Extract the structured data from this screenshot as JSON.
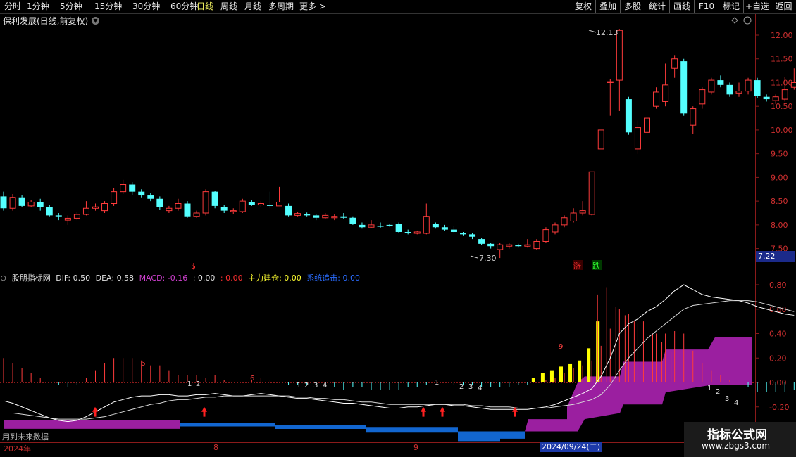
{
  "topbar": {
    "periods": [
      "分时",
      "1分钟",
      "5分钟",
      "15分钟",
      "30分钟",
      "60分钟",
      "日线",
      "周线",
      "月线",
      "多周期",
      "更多 >"
    ],
    "active_period": "日线",
    "buttons": [
      "复权",
      "叠加",
      "多股",
      "统计",
      "画线",
      "F10",
      "标记",
      "+自选",
      "返回"
    ]
  },
  "stock": {
    "title": "保利发展(日线,前复权)",
    "dropdown_icon": "chevron-down-icon",
    "last_price": "7.22"
  },
  "price_axis": [
    "12.00",
    "11.50",
    "11.00",
    "10.50",
    "10.00",
    "9.50",
    "9.00",
    "8.50",
    "8.00",
    "7.50"
  ],
  "annotations": {
    "high": "12.13",
    "low": "7.30",
    "rise_tag": "涨",
    "fall_tag": "跌",
    "dollar": "$"
  },
  "indicator": {
    "name": "股朋指标网",
    "dif": "DIF: 0.50",
    "dea": "DEA: 0.58",
    "macd": "MACD: -0.16",
    "v1": ": 0.00",
    "v2": ": 0.00",
    "main": "主力建仓: 0.00",
    "trend": "系统追击: 0.00"
  },
  "indicator_axis": [
    "0.80",
    "0.60",
    "0.40",
    "0.20",
    "0.00",
    "-0.20"
  ],
  "dates": {
    "year": "2024年",
    "m8": "8",
    "m9": "9",
    "selected": "2024/09/24(二)"
  },
  "footer": {
    "future_data": "用到未来数据"
  },
  "watermark": {
    "line1": "指标公式网",
    "line2": "www.zbgs3.com"
  },
  "colors": {
    "up": "#ff3b3b",
    "down": "#54ffff",
    "magenta": "#9b1fa0",
    "blue": "#1266d0",
    "yellow": "#ffff00"
  },
  "chart_data": {
    "type": "candlestick",
    "candles": [
      [
        8.6,
        8.35,
        8.7,
        8.3
      ],
      [
        8.35,
        8.58,
        8.65,
        8.3
      ],
      [
        8.58,
        8.4,
        8.62,
        8.38
      ],
      [
        8.4,
        8.48,
        8.52,
        8.38
      ],
      [
        8.48,
        8.38,
        8.55,
        8.3
      ],
      [
        8.38,
        8.2,
        8.42,
        8.18
      ],
      [
        8.2,
        8.18,
        8.25,
        8.1
      ],
      [
        8.1,
        8.14,
        8.2,
        8.0
      ],
      [
        8.14,
        8.22,
        8.28,
        8.1
      ],
      [
        8.22,
        8.35,
        8.5,
        8.2
      ],
      [
        8.35,
        8.38,
        8.45,
        8.3
      ],
      [
        8.3,
        8.45,
        8.5,
        8.25
      ],
      [
        8.45,
        8.7,
        8.78,
        8.4
      ],
      [
        8.7,
        8.85,
        8.95,
        8.65
      ],
      [
        8.85,
        8.7,
        8.9,
        8.62
      ],
      [
        8.7,
        8.62,
        8.75,
        8.58
      ],
      [
        8.62,
        8.55,
        8.68,
        8.5
      ],
      [
        8.55,
        8.38,
        8.6,
        8.32
      ],
      [
        8.3,
        8.35,
        8.4,
        8.25
      ],
      [
        8.35,
        8.45,
        8.55,
        8.3
      ],
      [
        8.45,
        8.18,
        8.5,
        8.15
      ],
      [
        8.18,
        8.25,
        8.3,
        8.15
      ],
      [
        8.25,
        8.7,
        8.75,
        8.2
      ],
      [
        8.7,
        8.4,
        8.72,
        8.35
      ],
      [
        8.38,
        8.3,
        8.42,
        8.25
      ],
      [
        8.28,
        8.3,
        8.35,
        8.22
      ],
      [
        8.28,
        8.5,
        8.55,
        8.25
      ],
      [
        8.48,
        8.42,
        8.52,
        8.4
      ],
      [
        8.42,
        8.45,
        8.5,
        8.38
      ],
      [
        8.42,
        8.4,
        8.7,
        8.35
      ],
      [
        8.4,
        8.48,
        8.8,
        8.4
      ],
      [
        8.4,
        8.2,
        8.45,
        8.18
      ],
      [
        8.2,
        8.24,
        8.28,
        8.18
      ],
      [
        8.22,
        8.2,
        8.26,
        8.18
      ],
      [
        8.2,
        8.15,
        8.22,
        8.1
      ],
      [
        8.15,
        8.2,
        8.25,
        8.12
      ],
      [
        8.15,
        8.18,
        8.22,
        8.1
      ],
      [
        8.18,
        8.15,
        8.25,
        8.12
      ],
      [
        8.15,
        8.02,
        8.18,
        8.0
      ],
      [
        8.0,
        7.95,
        8.05,
        7.92
      ],
      [
        7.95,
        8.0,
        8.1,
        7.94
      ],
      [
        7.98,
        7.96,
        8.05,
        7.94
      ],
      [
        8.0,
        7.98,
        8.02,
        7.96
      ],
      [
        8.02,
        7.85,
        8.05,
        7.83
      ],
      [
        7.85,
        7.82,
        7.9,
        7.8
      ],
      [
        7.82,
        7.85,
        7.88,
        7.8
      ],
      [
        7.82,
        8.18,
        8.45,
        7.8
      ],
      [
        8.02,
        7.95,
        8.05,
        7.92
      ],
      [
        7.95,
        7.9,
        8.0,
        7.88
      ],
      [
        7.9,
        7.85,
        7.98,
        7.82
      ],
      [
        7.82,
        7.8,
        7.85,
        7.78
      ],
      [
        7.8,
        7.75,
        7.82,
        7.7
      ],
      [
        7.7,
        7.6,
        7.72,
        7.58
      ],
      [
        7.6,
        7.55,
        7.62,
        7.5
      ],
      [
        7.48,
        7.58,
        7.62,
        7.3
      ],
      [
        7.55,
        7.58,
        7.62,
        7.5
      ],
      [
        7.58,
        7.55,
        7.6,
        7.52
      ],
      [
        7.55,
        7.58,
        7.7,
        7.52
      ],
      [
        7.5,
        7.65,
        7.7,
        7.48
      ],
      [
        7.65,
        7.9,
        7.95,
        7.62
      ],
      [
        7.85,
        8.0,
        8.05,
        7.8
      ],
      [
        8.0,
        8.15,
        8.2,
        7.95
      ],
      [
        8.08,
        8.25,
        8.35,
        8.05
      ],
      [
        8.25,
        8.3,
        8.5,
        8.2
      ],
      [
        8.22,
        9.12,
        9.12,
        8.2
      ],
      [
        9.6,
        10.0,
        10.0,
        9.6
      ],
      [
        11.0,
        11.02,
        11.08,
        10.3
      ],
      [
        11.05,
        12.1,
        12.13,
        10.4
      ],
      [
        10.65,
        9.95,
        10.7,
        9.9
      ],
      [
        9.6,
        10.05,
        10.2,
        9.5
      ],
      [
        9.95,
        10.25,
        10.5,
        9.8
      ],
      [
        10.5,
        10.8,
        10.9,
        10.45
      ],
      [
        10.6,
        10.95,
        11.4,
        10.5
      ],
      [
        11.3,
        11.5,
        11.58,
        11.1
      ],
      [
        11.45,
        10.35,
        11.5,
        10.3
      ],
      [
        10.1,
        10.45,
        10.5,
        9.92
      ],
      [
        10.55,
        10.85,
        10.9,
        10.45
      ],
      [
        10.8,
        11.05,
        11.1,
        10.75
      ],
      [
        11.05,
        10.95,
        11.15,
        10.9
      ],
      [
        10.95,
        10.75,
        11.0,
        10.7
      ],
      [
        10.78,
        10.82,
        11.0,
        10.7
      ],
      [
        10.82,
        11.05,
        11.1,
        10.75
      ],
      [
        11.05,
        10.72,
        11.1,
        10.68
      ],
      [
        10.7,
        10.65,
        10.75,
        10.6
      ],
      [
        10.62,
        10.7,
        10.75,
        10.55
      ],
      [
        10.65,
        10.85,
        11.12,
        10.6
      ],
      [
        10.9,
        11.0,
        11.3,
        10.85
      ]
    ],
    "dif": [
      -0.15,
      -0.17,
      -0.2,
      -0.23,
      -0.26,
      -0.29,
      -0.31,
      -0.32,
      -0.31,
      -0.28,
      -0.24,
      -0.2,
      -0.16,
      -0.14,
      -0.12,
      -0.11,
      -0.11,
      -0.1,
      -0.1,
      -0.11,
      -0.11,
      -0.1,
      -0.1,
      -0.09,
      -0.1,
      -0.11,
      -0.11,
      -0.1,
      -0.09,
      -0.1,
      -0.11,
      -0.12,
      -0.13,
      -0.13,
      -0.14,
      -0.15,
      -0.16,
      -0.17,
      -0.17,
      -0.18,
      -0.19,
      -0.2,
      -0.21,
      -0.21,
      -0.2,
      -0.2,
      -0.19,
      -0.18,
      -0.18,
      -0.19,
      -0.19,
      -0.2,
      -0.21,
      -0.22,
      -0.22,
      -0.22,
      -0.22,
      -0.22,
      -0.21,
      -0.2,
      -0.18,
      -0.15,
      -0.12,
      -0.09,
      -0.05,
      0.05,
      0.2,
      0.4,
      0.48,
      0.52,
      0.58,
      0.62,
      0.68,
      0.75,
      0.8,
      0.76,
      0.72,
      0.7,
      0.69,
      0.68,
      0.67,
      0.65,
      0.62,
      0.6,
      0.58,
      0.56,
      0.55
    ],
    "dea": [
      -0.25,
      -0.25,
      -0.26,
      -0.27,
      -0.28,
      -0.29,
      -0.3,
      -0.3,
      -0.3,
      -0.3,
      -0.29,
      -0.28,
      -0.26,
      -0.24,
      -0.22,
      -0.2,
      -0.18,
      -0.17,
      -0.15,
      -0.14,
      -0.14,
      -0.13,
      -0.12,
      -0.12,
      -0.11,
      -0.11,
      -0.11,
      -0.11,
      -0.11,
      -0.11,
      -0.11,
      -0.11,
      -0.12,
      -0.12,
      -0.13,
      -0.13,
      -0.14,
      -0.14,
      -0.15,
      -0.16,
      -0.16,
      -0.17,
      -0.18,
      -0.18,
      -0.18,
      -0.18,
      -0.18,
      -0.18,
      -0.18,
      -0.18,
      -0.18,
      -0.19,
      -0.19,
      -0.2,
      -0.2,
      -0.2,
      -0.21,
      -0.21,
      -0.21,
      -0.21,
      -0.2,
      -0.19,
      -0.18,
      -0.16,
      -0.14,
      -0.1,
      -0.02,
      0.1,
      0.2,
      0.28,
      0.36,
      0.42,
      0.48,
      0.54,
      0.6,
      0.63,
      0.64,
      0.65,
      0.66,
      0.67,
      0.67,
      0.67,
      0.66,
      0.64,
      0.62,
      0.6,
      0.58
    ]
  }
}
